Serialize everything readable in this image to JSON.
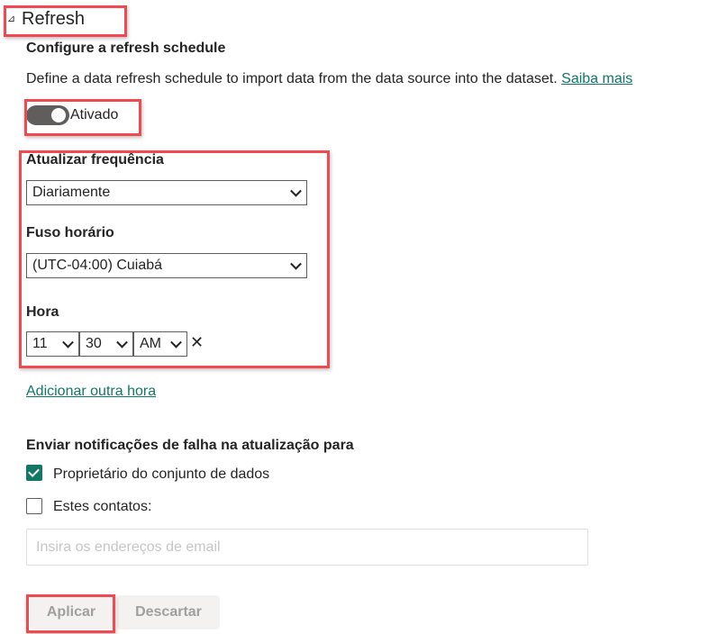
{
  "section": {
    "title": "Refresh",
    "collapse_icon": "triangle-icon"
  },
  "schedule": {
    "heading": "Configure a refresh schedule",
    "description": "Define a data refresh schedule to import data from the data source into the dataset.",
    "learn_more": "Saiba mais",
    "toggle": {
      "label": "Ativado",
      "on": true
    }
  },
  "frequency": {
    "label": "Atualizar frequência",
    "value": "Diariamente"
  },
  "timezone": {
    "label": "Fuso horário",
    "value": "(UTC-04:00) Cuiabá"
  },
  "time": {
    "label": "Hora",
    "hour": "11",
    "minute": "30",
    "ampm": "AM",
    "remove_icon": "close-icon"
  },
  "add_time": "Adicionar outra hora",
  "notifications": {
    "heading": "Enviar notificações de falha na atualização para",
    "owner": {
      "label": "Proprietário do conjunto de dados",
      "checked": true
    },
    "contacts": {
      "label": "Estes contatos:",
      "checked": false
    },
    "email_placeholder": "Insira os endereços de email"
  },
  "buttons": {
    "apply": "Aplicar",
    "discard": "Descartar"
  },
  "colors": {
    "accent": "#117865",
    "highlight": "#f0494f",
    "toggle": "#605e5c"
  }
}
